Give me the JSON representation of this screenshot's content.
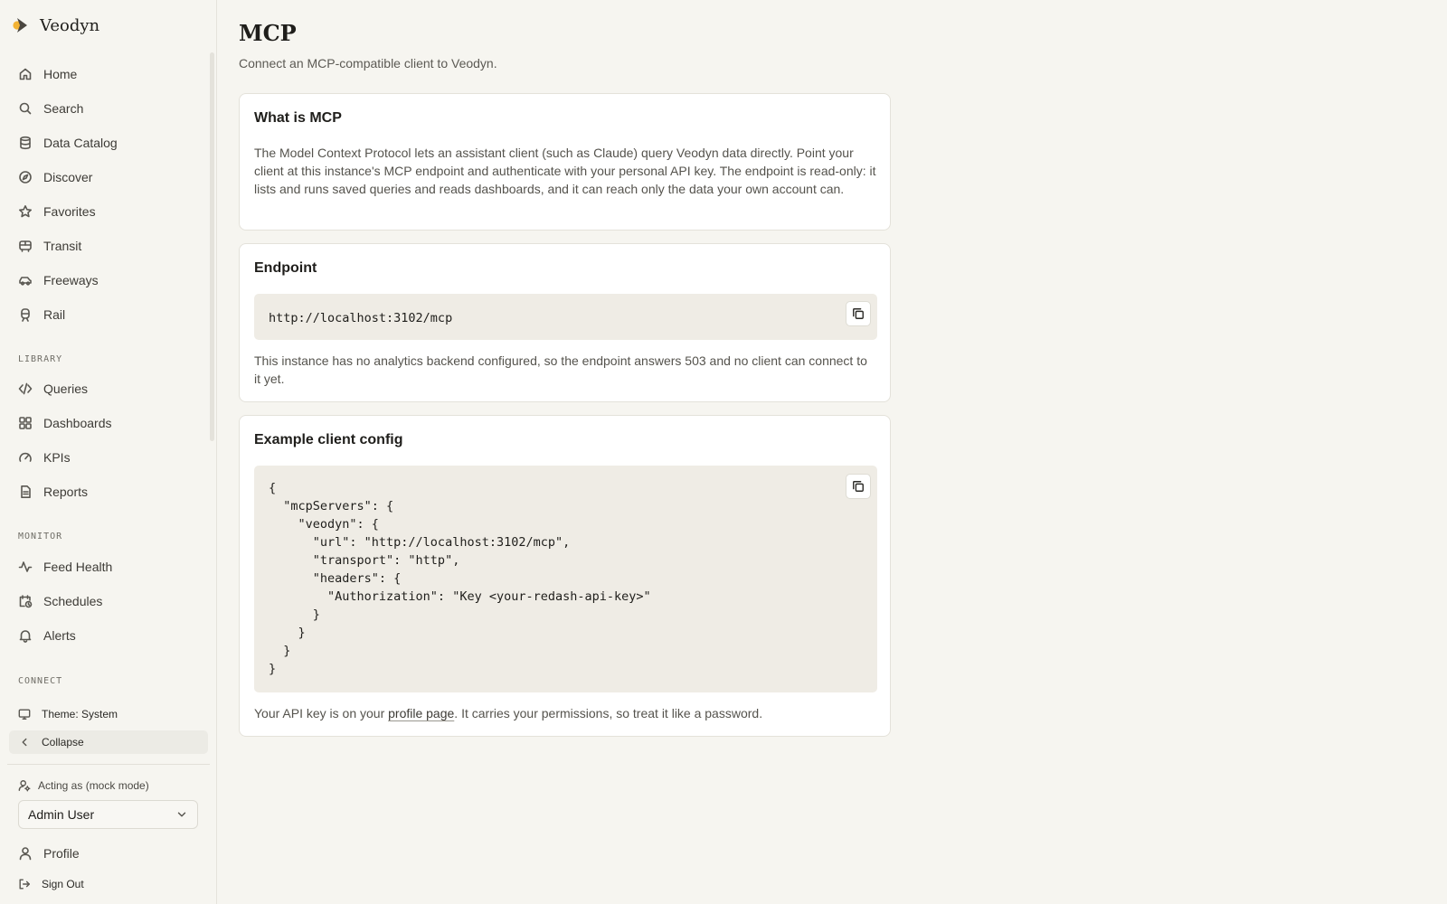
{
  "app": {
    "name": "Veodyn",
    "accent": "#f2b233",
    "accent_dark": "#4a4640"
  },
  "sidebar": {
    "main_items": [
      {
        "label": "Home",
        "icon": "home-icon"
      },
      {
        "label": "Search",
        "icon": "search-icon"
      },
      {
        "label": "Data Catalog",
        "icon": "database-icon"
      },
      {
        "label": "Discover",
        "icon": "compass-icon"
      },
      {
        "label": "Favorites",
        "icon": "star-icon"
      },
      {
        "label": "Transit",
        "icon": "bus-icon"
      },
      {
        "label": "Freeways",
        "icon": "car-icon"
      },
      {
        "label": "Rail",
        "icon": "train-icon"
      }
    ],
    "library_label": "LIBRARY",
    "library_items": [
      {
        "label": "Queries",
        "icon": "code-icon"
      },
      {
        "label": "Dashboards",
        "icon": "grid-icon"
      },
      {
        "label": "KPIs",
        "icon": "gauge-icon"
      },
      {
        "label": "Reports",
        "icon": "document-icon"
      }
    ],
    "monitor_label": "MONITOR",
    "monitor_items": [
      {
        "label": "Feed Health",
        "icon": "activity-icon"
      },
      {
        "label": "Schedules",
        "icon": "calendar-clock-icon"
      },
      {
        "label": "Alerts",
        "icon": "bell-icon"
      }
    ],
    "connect_label": "CONNECT",
    "theme_label": "Theme: System",
    "collapse_label": "Collapse",
    "acting_label": "Acting as (mock mode)",
    "acting_user": "Admin User",
    "profile_label": "Profile",
    "signout_label": "Sign Out"
  },
  "page": {
    "title": "MCP",
    "subtitle": "Connect an MCP-compatible client to Veodyn."
  },
  "what_is": {
    "title": "What is MCP",
    "text": "The Model Context Protocol lets an assistant client (such as Claude) query Veodyn data directly. Point your client at this instance's MCP endpoint and authenticate with your personal API key. The endpoint is read-only: it lists and runs saved queries and reads dashboards, and it can reach only the data your own account can."
  },
  "endpoint": {
    "title": "Endpoint",
    "url": "http://localhost:3102/mcp",
    "note": "This instance has no analytics backend configured, so the endpoint answers 503 and no client can connect to it yet."
  },
  "example": {
    "title": "Example client config",
    "code_lines": [
      "{",
      "  \"mcpServers\": {",
      "    \"veodyn\": {",
      "      \"url\": \"http://localhost:3102/mcp\",",
      "      \"transport\": \"http\",",
      "      \"headers\": {",
      "        \"Authorization\": \"Key <your-redash-api-key>\"",
      "      }",
      "    }",
      "  }",
      "}"
    ],
    "footer_prefix": "Your API key is on your ",
    "footer_link": "profile page",
    "footer_suffix": ". It carries your permissions, so treat it like a password."
  }
}
